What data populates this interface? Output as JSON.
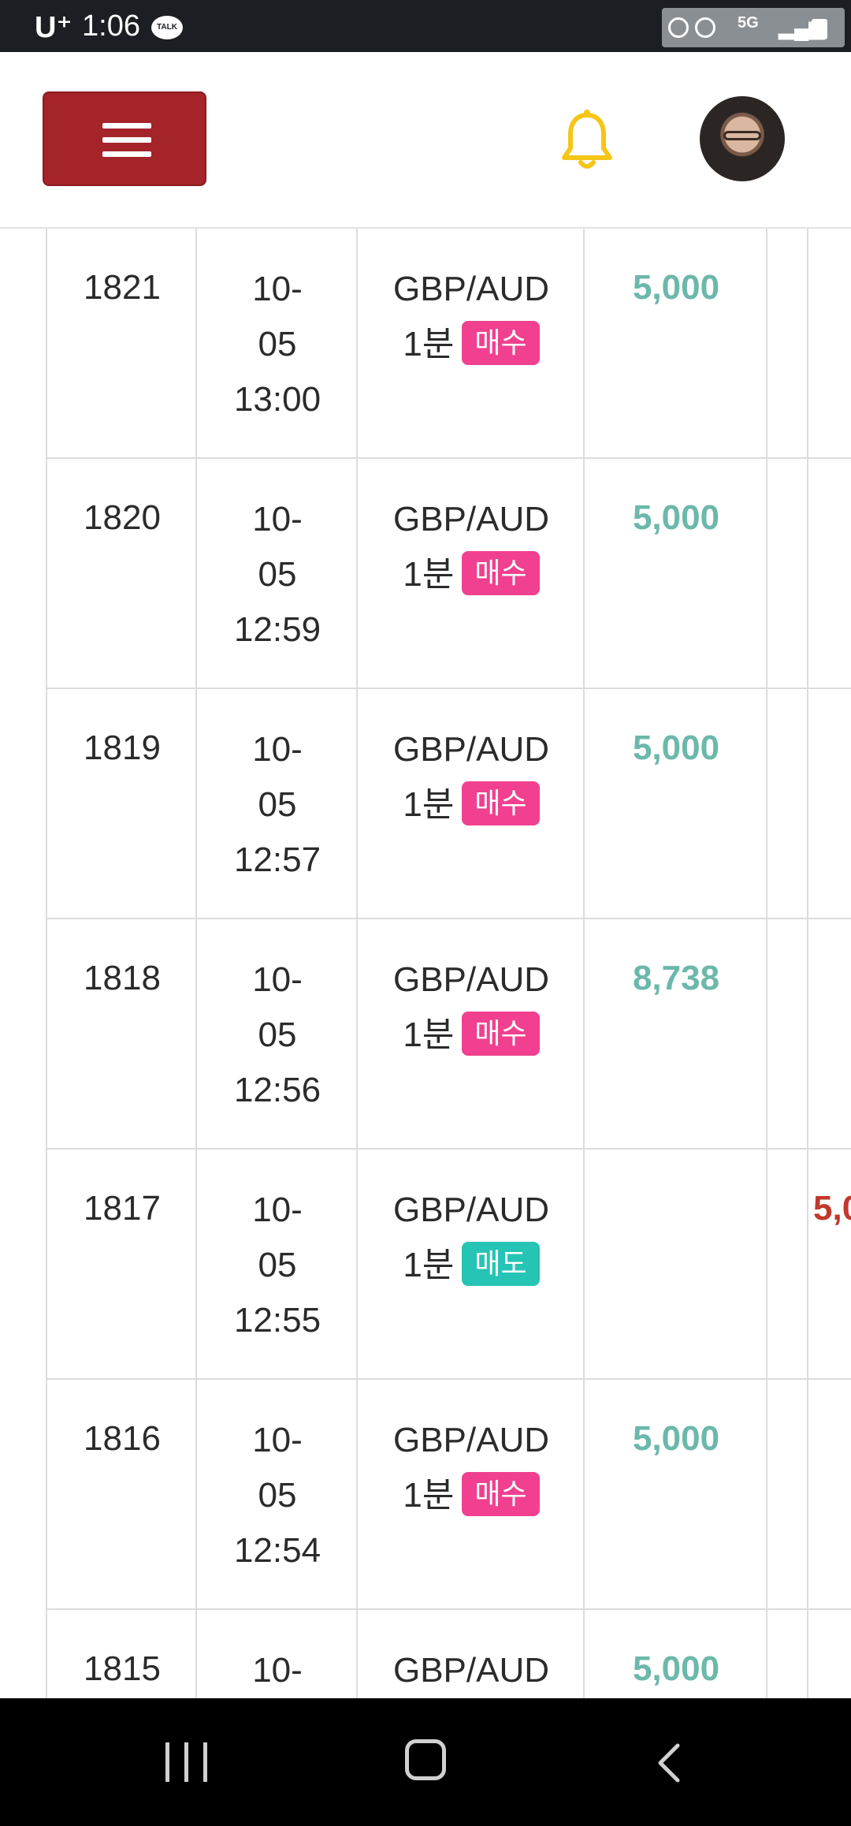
{
  "status_bar": {
    "carrier": "U⁺",
    "time": "1:06",
    "talk_icon": "TALK",
    "network": "5G"
  },
  "header": {
    "menu_icon": "hamburger-menu-icon",
    "bell_icon": "bell-icon",
    "bell_color": "#f5c518",
    "menu_color": "#a4242a"
  },
  "table": {
    "rows": [
      {
        "id": "1821",
        "date": "10-",
        "date2": "05",
        "time": "13:00",
        "pair": "GBP/AUD",
        "interval": "1분",
        "side": "매수",
        "side_type": "buy",
        "amount": "5,000",
        "loss": ""
      },
      {
        "id": "1820",
        "date": "10-",
        "date2": "05",
        "time": "12:59",
        "pair": "GBP/AUD",
        "interval": "1분",
        "side": "매수",
        "side_type": "buy",
        "amount": "5,000",
        "loss": ""
      },
      {
        "id": "1819",
        "date": "10-",
        "date2": "05",
        "time": "12:57",
        "pair": "GBP/AUD",
        "interval": "1분",
        "side": "매수",
        "side_type": "buy",
        "amount": "5,000",
        "loss": ""
      },
      {
        "id": "1818",
        "date": "10-",
        "date2": "05",
        "time": "12:56",
        "pair": "GBP/AUD",
        "interval": "1분",
        "side": "매수",
        "side_type": "buy",
        "amount": "8,738",
        "loss": ""
      },
      {
        "id": "1817",
        "date": "10-",
        "date2": "05",
        "time": "12:55",
        "pair": "GBP/AUD",
        "interval": "1분",
        "side": "매도",
        "side_type": "sell",
        "amount": "",
        "loss": "5,0"
      },
      {
        "id": "1816",
        "date": "10-",
        "date2": "05",
        "time": "12:54",
        "pair": "GBP/AUD",
        "interval": "1분",
        "side": "매수",
        "side_type": "buy",
        "amount": "5,000",
        "loss": ""
      },
      {
        "id": "1815",
        "date": "10-",
        "date2": "",
        "time": "",
        "pair": "GBP/AUD",
        "interval": "",
        "side": "",
        "side_type": "",
        "amount": "5,000",
        "loss": ""
      }
    ]
  },
  "nav_bar": {
    "recent_icon": "recent-apps-icon",
    "home_icon": "home-icon",
    "back_icon": "back-icon"
  }
}
